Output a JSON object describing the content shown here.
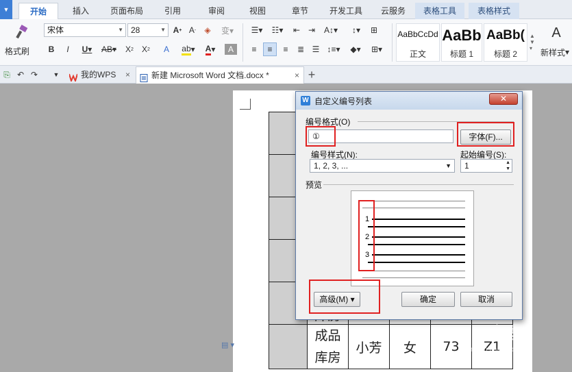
{
  "ribbon_tabs": [
    "开始",
    "插入",
    "页面布局",
    "引用",
    "审阅",
    "视图",
    "章节",
    "开发工具",
    "云服务",
    "表格工具",
    "表格样式"
  ],
  "ribbon": {
    "format_painter": "格式刷",
    "font_name": "宋体",
    "font_size": "28",
    "styles": [
      {
        "preview": "AaBbCcDd",
        "name": "正文"
      },
      {
        "preview": "AaBb",
        "name": "标题 1"
      },
      {
        "preview": "AaBb(",
        "name": "标题 2"
      }
    ],
    "new_style": "新样式"
  },
  "doc_tabs": [
    {
      "label": "我的WPS"
    },
    {
      "label": "新建 Microsoft Word 文档.docx *"
    }
  ],
  "table": {
    "row_last": [
      "成品库房",
      "小芳",
      "女",
      "73",
      "Z1"
    ],
    "row_partial": "库房"
  },
  "dialog": {
    "title": "自定义编号列表",
    "close": "✕",
    "format_label": "编号格式(O)",
    "format_value": "①",
    "font_button": "字体(F)...",
    "style_label": "编号样式(N):",
    "style_value": "1, 2, 3, ...",
    "start_label": "起始编号(S):",
    "start_value": "1",
    "preview_label": "预览",
    "preview_numbers": [
      "1",
      "2",
      "3"
    ],
    "advanced_button": "高级(M) ▾",
    "ok_button": "确定",
    "cancel_button": "取消"
  },
  "watermark": {
    "main": "Baidu经验",
    "sub": "jingyan.baidu.com"
  },
  "colors": {
    "accent": "#2a6bc4",
    "highlight": "#e02020",
    "context_tab": "#d6e2f2"
  }
}
